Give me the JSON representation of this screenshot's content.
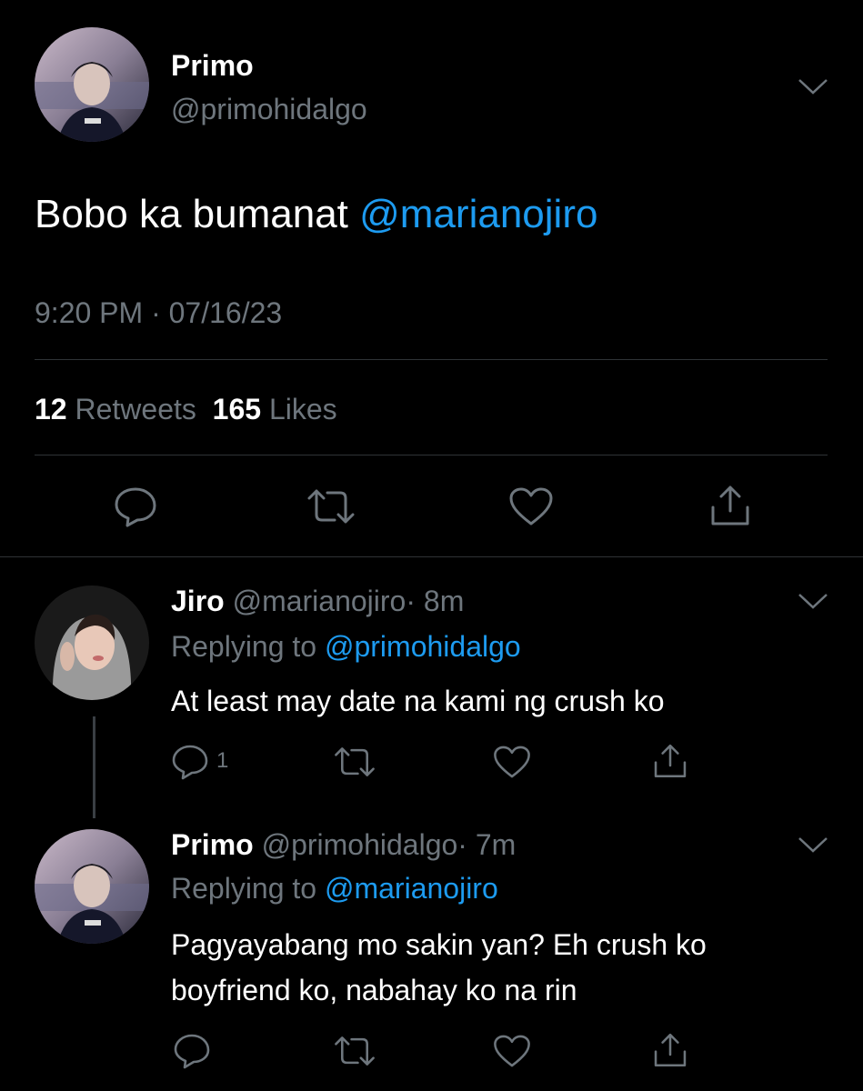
{
  "colors": {
    "background": "#000000",
    "text_primary": "#ffffff",
    "text_secondary": "#6e767d",
    "accent": "#1d9bf0",
    "divider": "#2f3336"
  },
  "main_tweet": {
    "name": "Primo",
    "handle": "@primohidalgo",
    "text": "Bobo ka bumanat ",
    "mention": "@marianojiro",
    "timestamp": "9:20 PM · 07/16/23",
    "retweets_count": "12",
    "retweets_label": "Retweets",
    "likes_count": "165",
    "likes_label": "Likes",
    "icons": [
      "reply-icon",
      "retweet-icon",
      "like-icon",
      "share-icon"
    ]
  },
  "replies": [
    {
      "name": "Jiro",
      "handle": "@marianojiro",
      "time": "· 8m",
      "replying_label": "Replying to ",
      "replying_to": "@primohidalgo",
      "text": "At least may date na kami ng crush ko",
      "reply_count": "1"
    },
    {
      "name": "Primo",
      "handle": "@primohidalgo",
      "time": "· 7m",
      "replying_label": "Replying to ",
      "replying_to": "@marianojiro",
      "text": "Pagyayabang mo sakin yan? Eh crush ko boyfriend ko, nabahay ko na rin",
      "reply_count": ""
    }
  ]
}
